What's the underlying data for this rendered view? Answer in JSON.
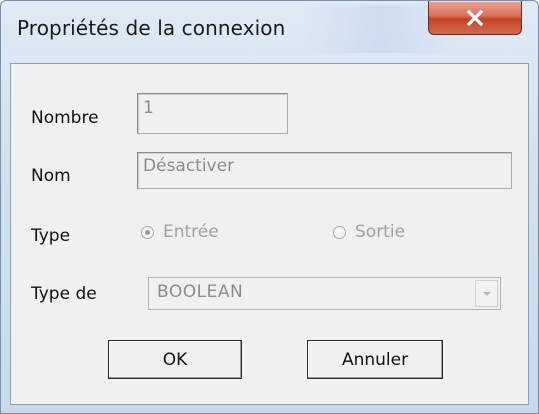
{
  "window": {
    "title": "Propriétés de la connexion",
    "close_icon": "close-x-icon"
  },
  "form": {
    "number": {
      "label": "Nombre",
      "value": "1"
    },
    "name": {
      "label": "Nom",
      "value": "Désactiver"
    },
    "type": {
      "label": "Type",
      "options": [
        {
          "label": "Entrée",
          "checked": true
        },
        {
          "label": "Sortie",
          "checked": false
        }
      ]
    },
    "data_type": {
      "label": "Type de",
      "selected": "BOOLEAN"
    }
  },
  "buttons": {
    "ok": "OK",
    "cancel": "Annuler"
  },
  "colors": {
    "close_button": "#d0573f",
    "dialog_background": "#f0f0f0",
    "frame": "#d3e1ef"
  }
}
